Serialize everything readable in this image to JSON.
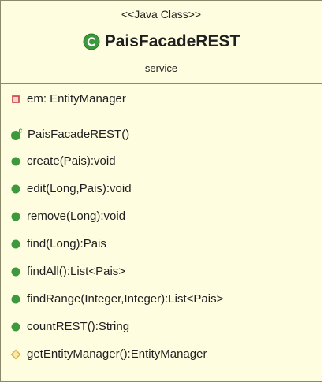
{
  "class_box": {
    "stereotype": "<<Java Class>>",
    "name": "PaisFacadeREST",
    "package": "service"
  },
  "attributes": [
    {
      "text": "em: EntityManager",
      "visibility": "private"
    }
  ],
  "operations": [
    {
      "text": "PaisFacadeREST()",
      "visibility": "public",
      "kind": "constructor"
    },
    {
      "text": "create(Pais):void",
      "visibility": "public"
    },
    {
      "text": "edit(Long,Pais):void",
      "visibility": "public"
    },
    {
      "text": "remove(Long):void",
      "visibility": "public"
    },
    {
      "text": "find(Long):Pais",
      "visibility": "public"
    },
    {
      "text": "findAll():List<Pais>",
      "visibility": "public"
    },
    {
      "text": "findRange(Integer,Integer):List<Pais>",
      "visibility": "public"
    },
    {
      "text": "countREST():String",
      "visibility": "public"
    },
    {
      "text": "getEntityManager():EntityManager",
      "visibility": "protected"
    }
  ],
  "colors": {
    "box_fill": "#fffde0",
    "box_border": "#8a8a6a",
    "public_green": "#3c9a3c",
    "private_red": "#c83c3c",
    "protected_yellow": "#d8b340"
  },
  "icons": {
    "class": "class-c-icon",
    "private": "private-square-icon",
    "public": "public-circle-icon",
    "constructor": "constructor-icon",
    "protected": "protected-diamond-icon"
  }
}
